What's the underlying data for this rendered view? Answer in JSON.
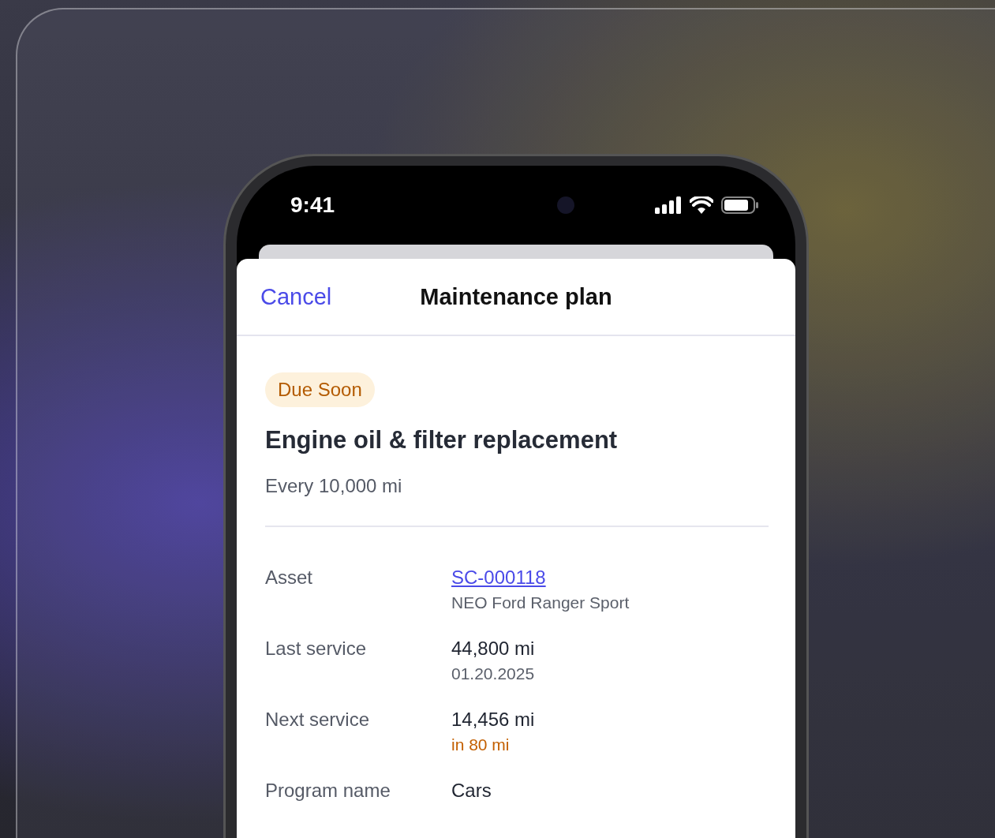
{
  "status_bar": {
    "time": "9:41"
  },
  "header": {
    "cancel": "Cancel",
    "title": "Maintenance plan"
  },
  "plan": {
    "badge": "Due Soon",
    "title": "Engine oil & filter replacement",
    "interval": "Every 10,000 mi"
  },
  "details": [
    {
      "label": "Asset",
      "value": "SC-000118",
      "sub": "NEO Ford Ranger Sport",
      "kind": "link"
    },
    {
      "label": "Last service",
      "value": "44,800 mi",
      "sub": "01.20.2025",
      "kind": "plain"
    },
    {
      "label": "Next service",
      "value": "14,456 mi",
      "sub": "in 80 mi",
      "kind": "warning"
    },
    {
      "label": "Program name",
      "value": "Cars",
      "kind": "plain"
    }
  ]
}
